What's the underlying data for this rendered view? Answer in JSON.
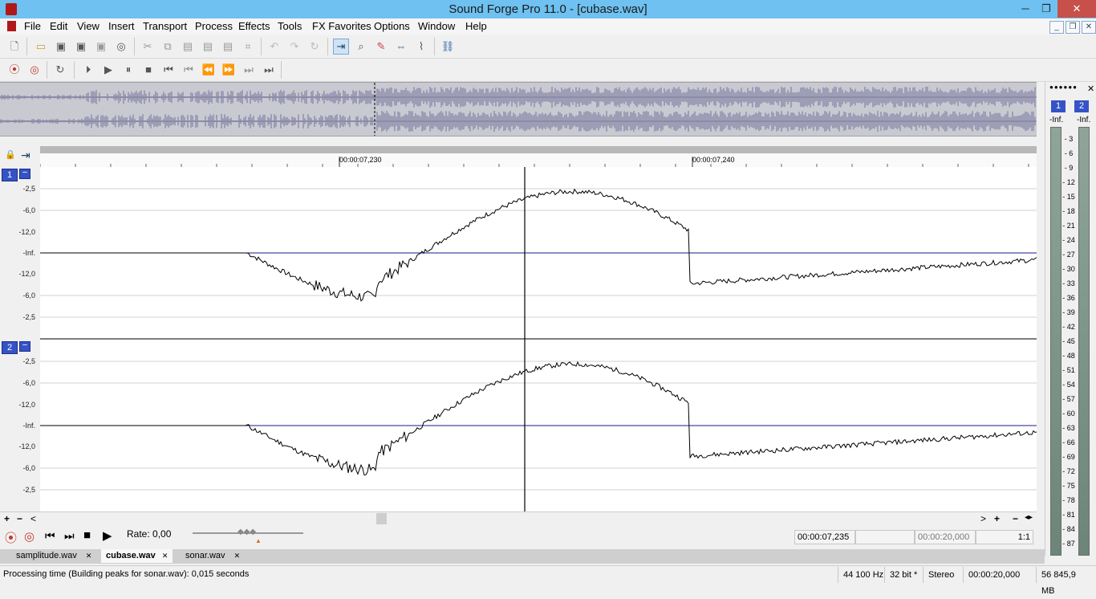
{
  "window": {
    "title": "Sound Forge Pro 11.0 - [cubase.wav]",
    "min": "─",
    "max": "❐",
    "close": "✕"
  },
  "menu": [
    "File",
    "Edit",
    "View",
    "Insert",
    "Transport",
    "Process",
    "Effects",
    "Tools",
    "FX Favorites",
    "Options",
    "Window",
    "Help"
  ],
  "mdi": {
    "min": "_",
    "restore": "❐",
    "close": "✕"
  },
  "toolbar_icons": [
    "new-icon",
    "open-icon",
    "save-icon",
    "save-as-icon",
    "render-icon",
    "burn-icon",
    "cut-icon",
    "copy-icon",
    "paste-icon",
    "paste-mix-icon",
    "paste-crossfade-icon",
    "trim-icon",
    "undo-icon",
    "redo-icon",
    "repeat-icon",
    "edit-tool-icon",
    "magnify-tool-icon",
    "pencil-tool-icon",
    "event-tool-icon",
    "envelope-tool-icon",
    "plugin-chainer-icon"
  ],
  "transport_icons": [
    "record-icon",
    "record-arm-icon",
    "loop-icon",
    "play-all-icon",
    "play-icon",
    "pause-icon",
    "stop-icon",
    "go-start-icon",
    "prev-marker-icon",
    "rewind-icon",
    "forward-icon",
    "next-marker-icon",
    "go-end-icon"
  ],
  "ruler": {
    "t1": "00:00:07,230",
    "t2": "00:00:07,240"
  },
  "channels": [
    {
      "badge": "1",
      "collapse": "−",
      "db": [
        "-2,5",
        "-6,0",
        "-12,0",
        "-Inf.",
        "-12,0",
        "-6,0",
        "-2,5"
      ]
    },
    {
      "badge": "2",
      "collapse": "−",
      "db": [
        "-2,5",
        "-6,0",
        "-12,0",
        "-Inf.",
        "-12,0",
        "-6,0",
        "-2,5"
      ]
    }
  ],
  "meter": {
    "ch1": "1",
    "ch2": "2",
    "peak1": "-Inf.",
    "peak2": "-Inf.",
    "scale": [
      "3",
      "6",
      "9",
      "12",
      "15",
      "18",
      "21",
      "24",
      "27",
      "30",
      "33",
      "36",
      "39",
      "42",
      "45",
      "48",
      "51",
      "54",
      "57",
      "60",
      "63",
      "66",
      "69",
      "72",
      "75",
      "78",
      "81",
      "84",
      "87"
    ]
  },
  "bottom": {
    "zoom_in": "+",
    "zoom_out": "−",
    "left": "<",
    "right": ">",
    "rate": "Rate: 0,00",
    "position": "00:00:07,235",
    "selection": "",
    "length": "00:00:20,000",
    "zoom_ratio": "1:1"
  },
  "tabs": [
    {
      "label": "samplitude.wav",
      "close": "✕"
    },
    {
      "label": "cubase.wav",
      "close": "✕"
    },
    {
      "label": "sonar.wav",
      "close": "✕"
    }
  ],
  "status": {
    "message": "Processing time (Building peaks for sonar.wav): 0,015 seconds",
    "rate": "44 100 Hz",
    "bits": "32 bit *",
    "channels": "Stereo",
    "length": "00:00:20,000",
    "space": "56 845,9 MB"
  },
  "colors": {
    "titlebar": "#6ec1f0",
    "channel_badge": "#3553c6",
    "waveform": "#000000",
    "baseline": "#1a1a8c"
  }
}
